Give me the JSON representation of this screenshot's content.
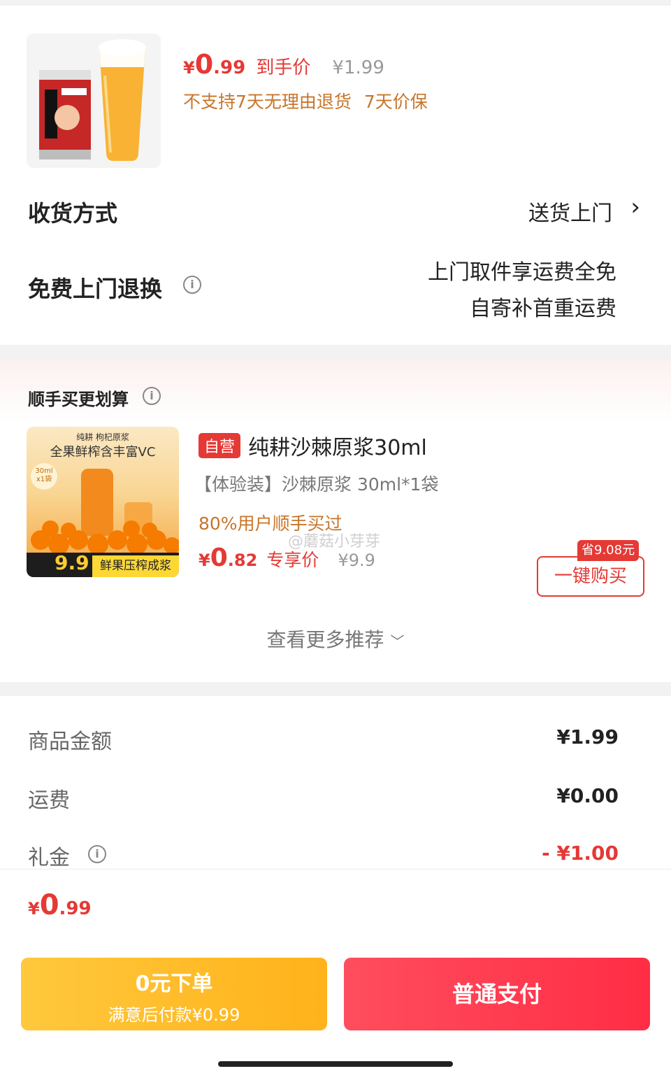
{
  "product": {
    "price_yen": "¥",
    "price_int": "0",
    "price_dec": ".99",
    "price_label": "到手价",
    "original_price": "¥1.99",
    "policy_no_return": "不支持7天无理由退货",
    "policy_price_protect": "7天价保"
  },
  "delivery": {
    "label": "收货方式",
    "value": "送货上门",
    "chevron": "›"
  },
  "free_return": {
    "label": "免费上门退换",
    "line1": "上门取件享运费全免",
    "line2": "自寄补首重运费"
  },
  "recommend": {
    "title": "顺手买更划算",
    "tag": "自营",
    "name": "纯耕沙棘原浆30ml",
    "spec": "【体验装】沙棘原浆 30ml*1袋",
    "bought_hint": "80%用户顺手买过",
    "price_yen": "¥",
    "price_int": "0",
    "price_dec": ".82",
    "price_label": "专享价",
    "original_price": "¥9.9",
    "save_badge": "省9.08元",
    "buy_button": "一键购买",
    "more": "查看更多推荐",
    "img_brand": "纯耕 枸杞原浆",
    "img_slogan": "全果鲜榨含丰富VC",
    "img_price": "9.9",
    "img_footer": "鲜果压榨成浆",
    "img_chip": "30ml x1袋"
  },
  "summary": {
    "items": [
      {
        "label": "商品金额",
        "value": "¥1.99"
      },
      {
        "label": "运费",
        "value": "¥0.00"
      },
      {
        "label": "礼金",
        "value": "- ¥1.00"
      }
    ]
  },
  "footer": {
    "total_yen": "¥",
    "total_int": "0",
    "total_dec": ".99",
    "btn_zero_title": "0元下单",
    "btn_zero_sub": "满意后付款¥0.99",
    "btn_pay": "普通支付"
  },
  "watermark": "@蘑菇小芽芽",
  "colors": {
    "accent_red": "#e53935",
    "policy_orange": "#c8752a",
    "pay_yellow": "#ffb21a",
    "pay_red": "#ff2d45"
  }
}
